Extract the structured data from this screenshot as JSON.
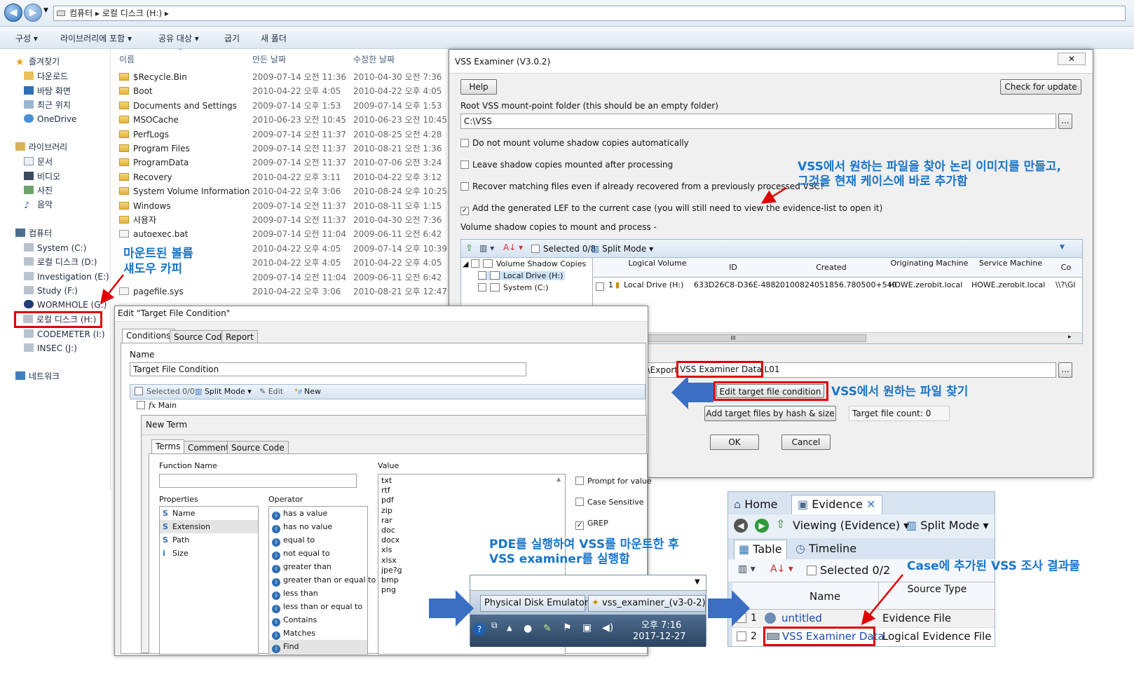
{
  "explorer": {
    "breadcrumb": [
      "컴퓨터",
      "로컬 디스크 (H:)"
    ],
    "toolbar": [
      "구성",
      "라이브러리에 포함",
      "공유 대상",
      "굽기",
      "새 폴더"
    ],
    "nav": {
      "favorites": "즐겨찾기",
      "fav_items": [
        "다운로드",
        "바탕 화면",
        "최근 위치",
        "OneDrive"
      ],
      "libraries": "라이브러리",
      "lib_items": [
        "문서",
        "비디오",
        "사진",
        "음악"
      ],
      "computer": "컴퓨터",
      "drives": [
        "System (C:)",
        "로컬 디스크 (D:)",
        "Investigation (E:)",
        "Study (F:)",
        "WORMHOLE (G:)",
        "로컬 디스크 (H:)",
        "CODEMETER (I:)",
        "INSEC (J:)"
      ],
      "network": "네트워크"
    },
    "columns": [
      "이름",
      "만든 날짜",
      "수정한 날짜"
    ],
    "files": [
      {
        "name": "$Recycle.Bin",
        "created": "2009-07-14 오전 11:36",
        "modified": "2010-04-30 오전 7:36"
      },
      {
        "name": "Boot",
        "created": "2010-04-22 오후 4:05",
        "modified": "2010-04-22 오후 4:05"
      },
      {
        "name": "Documents and Settings",
        "created": "2009-07-14 오후 1:53",
        "modified": "2009-07-14 오후 1:53"
      },
      {
        "name": "MSOCache",
        "created": "2010-06-23 오전 10:45",
        "modified": "2010-06-23 오전 10:45"
      },
      {
        "name": "PerfLogs",
        "created": "2009-07-14 오전 11:37",
        "modified": "2010-08-25 오전 4:28"
      },
      {
        "name": "Program Files",
        "created": "2009-07-14 오전 11:37",
        "modified": "2010-08-21 오전 1:36"
      },
      {
        "name": "ProgramData",
        "created": "2009-07-14 오전 11:37",
        "modified": "2010-07-06 오전 3:24"
      },
      {
        "name": "Recovery",
        "created": "2010-04-22 오후 3:11",
        "modified": "2010-04-22 오후 3:12"
      },
      {
        "name": "System Volume Information",
        "created": "2010-04-22 오후 3:06",
        "modified": "2010-08-24 오후 10:25"
      },
      {
        "name": "Windows",
        "created": "2009-07-14 오전 11:37",
        "modified": "2010-08-11 오후 1:15"
      },
      {
        "name": "사용자",
        "created": "2009-07-14 오전 11:37",
        "modified": "2010-04-30 오전 7:36"
      },
      {
        "name": "autoexec.bat",
        "created": "2009-07-14 오전 11:04",
        "modified": "2009-06-11 오전 6:42"
      },
      {
        "name": "",
        "created": "2010-04-22 오후 4:05",
        "modified": "2009-07-14 오후 10:39"
      },
      {
        "name": "",
        "created": "2010-04-22 오후 4:05",
        "modified": "2010-04-22 오후 4:05"
      },
      {
        "name": "",
        "created": "2009-07-14 오전 11:04",
        "modified": "2009-06-11 오전 6:42"
      },
      {
        "name": "pagefile.sys",
        "created": "2010-04-22 오후 3:06",
        "modified": "2010-08-21 오후 12:47"
      }
    ]
  },
  "vss": {
    "title": "VSS Examiner (V3.0.2)",
    "help": "Help",
    "check_update": "Check for update",
    "root_label": "Root VSS mount-point folder (this should be an empty folder)",
    "root_value": "C:\\VSS",
    "browse": "...",
    "opt1": "Do not mount volume shadow copies automatically",
    "opt2": "Leave shadow copies mounted after processing",
    "opt3": "Recover matching files even if already recovered from a previously processed VSC?",
    "opt4": "Add the generated LEF to the current case (you will still need to view the evidence-list to open it)",
    "volumes_label": "Volume shadow copies to mount and process -",
    "grid_selected": "Selected 0/8",
    "grid_split": "Split Mode",
    "tree": [
      "Volume Shadow Copies",
      "Local Drive (H:)",
      "System (C:)"
    ],
    "grid_cols": [
      "Logical Volume",
      "ID",
      "Created",
      "Originating Machine",
      "Service Machine",
      "Co"
    ],
    "grid_row": {
      "num": "1",
      "volume": "Local Drive (H:)",
      "id": "633D26C8-D36E-488...",
      "created": "20100824051856.780500+540",
      "orig": "HOWE.zerobit.local",
      "service": "HOWE.zerobit.local",
      "co": "\\\\?\\Gl"
    },
    "scroll_mark": "III",
    "export_prefix": "0\\Export",
    "export_file": "VSS Examiner Data.L01",
    "edit_target_btn": "Edit target file condition",
    "add_hash_btn": "Add target files by hash & size",
    "target_count": "Target file count: 0",
    "ok": "OK",
    "cancel": "Cancel"
  },
  "edit": {
    "title": "Edit \"Target File Condition\"",
    "tabs": [
      "Conditions",
      "Source Code",
      "Report"
    ],
    "name_label": "Name",
    "name_value": "Target File Condition",
    "toolbar_selected": "Selected 0/0",
    "toolbar_split": "Split Mode",
    "toolbar_edit": "Edit",
    "toolbar_new": "New",
    "tree_main": "Main",
    "new_term": "New Term",
    "term_tabs": [
      "Terms",
      "Comment",
      "Source Code"
    ],
    "function_name": "Function Name",
    "value_label": "Value",
    "properties_label": "Properties",
    "properties": [
      "Name",
      "Extension",
      "Path",
      "Size"
    ],
    "operator_label": "Operator",
    "operators": [
      "has a value",
      "has no value",
      "equal to",
      "not equal to",
      "greater than",
      "greater than or equal to",
      "less than",
      "less than or equal to",
      "Contains",
      "Matches",
      "Find"
    ],
    "values": [
      "txt",
      "rtf",
      "pdf",
      "zip",
      "rar",
      "doc",
      "docx",
      "xls",
      "xlsx",
      "jpe?g",
      "bmp",
      "png"
    ],
    "prompt": "Prompt for value",
    "case": "Case Sensitive",
    "grep": "GREP"
  },
  "taskbar": {
    "items": [
      "Physical Disk Emulator",
      "vss_examiner_(v3-0-2)"
    ],
    "time": "오후 7:16",
    "date": "2017-12-27"
  },
  "evidence": {
    "tabs": [
      "Home",
      "Evidence"
    ],
    "viewing": "Viewing (Evidence)",
    "split": "Split Mode",
    "table": "Table",
    "timeline": "Timeline",
    "selected": "Selected 0/2",
    "col_name": "Name",
    "col_source": "Source Type",
    "rows": [
      {
        "num": "1",
        "name": "untitled",
        "type": "Evidence File"
      },
      {
        "num": "2",
        "name": "VSS Examiner Data",
        "type": "Logical Evidence File"
      }
    ]
  },
  "annotations": {
    "a1": "VSS에서 원하는 파일을 찾아 논리 이미지를 만들고,",
    "a1b": "그것을 현재 케이스에 바로 추가함",
    "a2": "마운트된 볼륨",
    "a2b": "섀도우 카피",
    "a3": "VSS에서 원하는 파일 찾기",
    "a4": "PDE를 실행하여 VSS를 마운트한 후",
    "a4b": "VSS examiner를 실행함",
    "a5": "Case에 추가된 VSS 조사 결과물"
  },
  "colors": {
    "highlight": "#e00000",
    "annotation": "#1a75c9",
    "arrow": "#3a6fc4"
  }
}
